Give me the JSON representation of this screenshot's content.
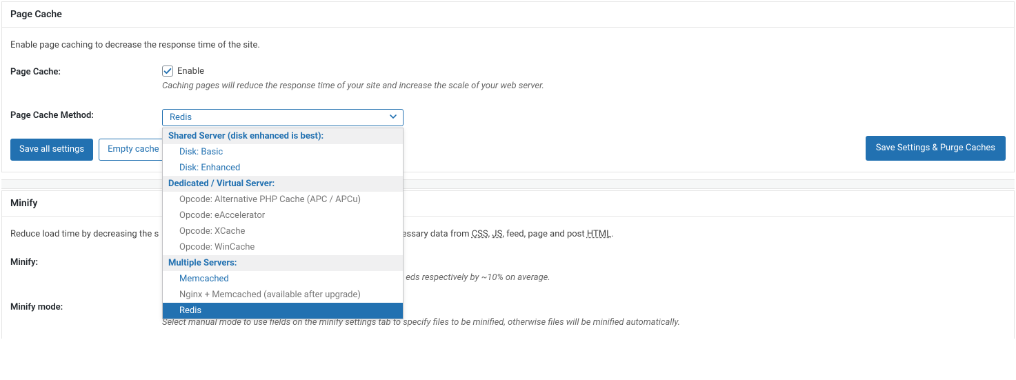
{
  "page_cache": {
    "title": "Page Cache",
    "intro": "Enable page caching to decrease the response time of the site.",
    "enable_label": "Page Cache:",
    "enable_checkbox_label": "Enable",
    "enable_checked": true,
    "enable_description": "Caching pages will reduce the response time of your site and increase the scale of your web server.",
    "method_label": "Page Cache Method:",
    "method_selected": "Redis",
    "dropdown": {
      "group1_label": "Shared Server (disk enhanced is best):",
      "group1_options": [
        "Disk: Basic",
        "Disk: Enhanced"
      ],
      "group2_label": "Dedicated / Virtual Server:",
      "group2_options": [
        "Opcode: Alternative PHP Cache (APC / APCu)",
        "Opcode: eAccelerator",
        "Opcode: XCache",
        "Opcode: WinCache"
      ],
      "group3_label": "Multiple Servers:",
      "group3_options": [
        "Memcached",
        "Nginx + Memcached (available after upgrade)",
        "Redis"
      ]
    },
    "save_all_label": "Save all settings",
    "empty_cache_label": "Empty cache",
    "save_purge_label": "Save Settings & Purge Caches"
  },
  "minify": {
    "title": "Minify",
    "intro_pre": "Reduce load time by decreasing the s",
    "intro_mid": "ncessary data from ",
    "abbr_css": "CSS",
    "comma1": ", ",
    "abbr_js": "JS",
    "intro_mid2": ", feed, page and post ",
    "abbr_html": "HTML",
    "intro_end": ".",
    "minify_label": "Minify:",
    "minify_hint_tail": "eds respectively by ~10% on average.",
    "mode_label": "Minify mode:",
    "mode_description": "Select manual mode to use fields on the minify settings tab to specify files to be minified, otherwise files will be minified automatically."
  }
}
